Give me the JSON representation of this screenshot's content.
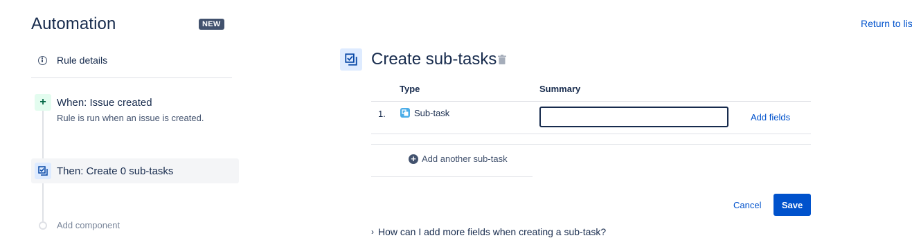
{
  "header": {
    "title": "Automation",
    "badge": "NEW",
    "return_link": "Return to list"
  },
  "sidebar": {
    "rule_details": "Rule details",
    "trigger": {
      "icon_glyph": "+",
      "title": "When: Issue created",
      "description": "Rule is run when an issue is created."
    },
    "action": {
      "title": "Then: Create 0 sub-tasks"
    },
    "add_component": "Add component"
  },
  "panel": {
    "title": "Create sub-tasks",
    "columns": {
      "type": "Type",
      "summary": "Summary"
    },
    "rows": [
      {
        "number": "1.",
        "type": "Sub-task",
        "summary_value": "",
        "add_fields": "Add fields"
      }
    ],
    "add_another": "Add another sub-task",
    "plus_glyph": "+",
    "cancel": "Cancel",
    "save": "Save",
    "faq_chevron": "›",
    "faq": "How can I add more fields when creating a sub-task?"
  },
  "colors": {
    "brand": "#0052cc",
    "text": "#172b4d",
    "badge_bg": "#42526e",
    "trigger_bg": "#e3fcef",
    "action_bg": "#deebff",
    "subtask_icon": "#4bade8"
  }
}
